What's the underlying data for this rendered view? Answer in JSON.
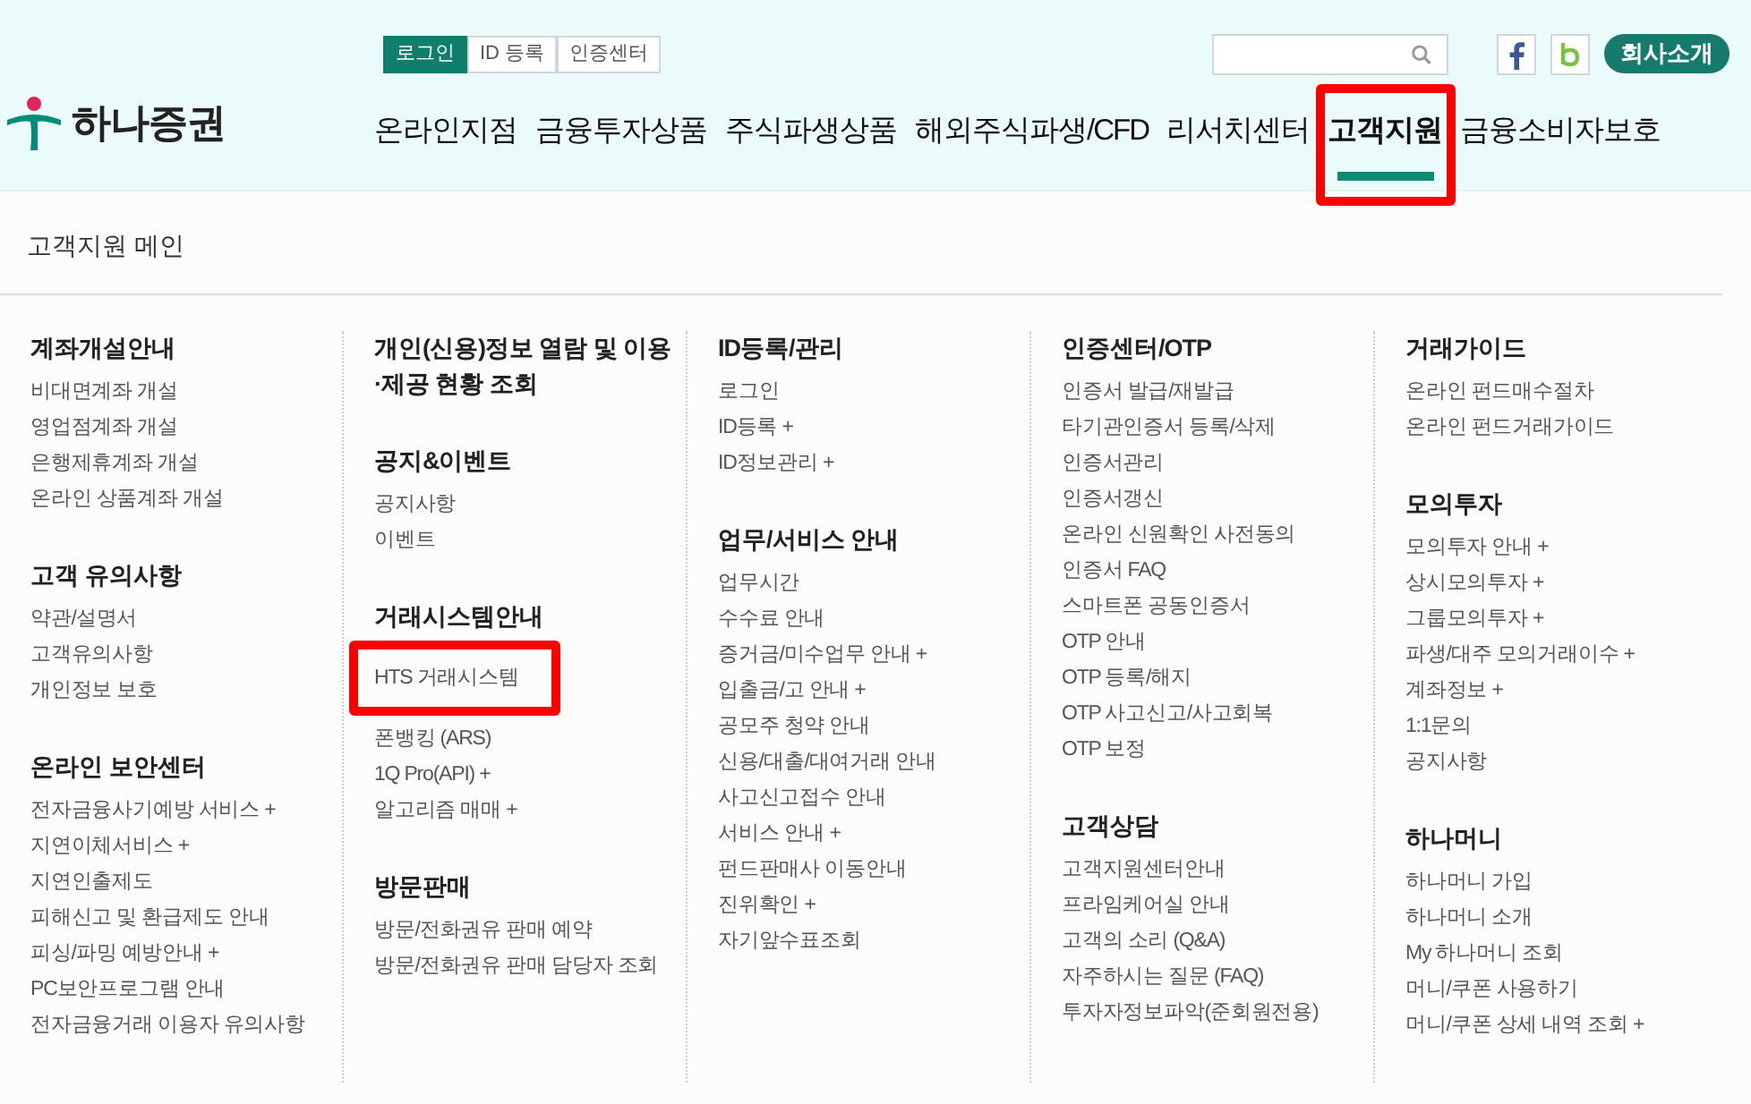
{
  "header": {
    "logo": "하나증권",
    "top_links": [
      {
        "label": "로그인",
        "selected": true
      },
      {
        "label": "ID 등록",
        "selected": false
      },
      {
        "label": "인증센터",
        "selected": false
      }
    ],
    "company_button": "회사소개",
    "nav": [
      {
        "label": "온라인지점",
        "selected": false,
        "highlighted": false
      },
      {
        "label": "금융투자상품",
        "selected": false,
        "highlighted": false
      },
      {
        "label": "주식파생상품",
        "selected": false,
        "highlighted": false
      },
      {
        "label": "해외주식파생/CFD",
        "selected": false,
        "highlighted": false
      },
      {
        "label": "리서치센터",
        "selected": false,
        "highlighted": false
      },
      {
        "label": "고객지원",
        "selected": true,
        "highlighted": true
      },
      {
        "label": "금융소비자보호",
        "selected": false,
        "highlighted": false
      }
    ]
  },
  "page_title": "고객지원 메인",
  "columns": [
    {
      "sections": [
        {
          "heading": "계좌개설안내",
          "links": [
            {
              "label": "비대면계좌 개설",
              "highlighted": false
            },
            {
              "label": "영업점계좌 개설",
              "highlighted": false
            },
            {
              "label": "은행제휴계좌 개설",
              "highlighted": false
            },
            {
              "label": "온라인 상품계좌 개설",
              "highlighted": false
            }
          ]
        },
        {
          "heading": "고객 유의사항",
          "links": [
            {
              "label": "약관/설명서",
              "highlighted": false
            },
            {
              "label": "고객유의사항",
              "highlighted": false
            },
            {
              "label": "개인정보 보호",
              "highlighted": false
            }
          ]
        },
        {
          "heading": "온라인 보안센터",
          "links": [
            {
              "label": "전자금융사기예방 서비스 +",
              "highlighted": false
            },
            {
              "label": "지연이체서비스 +",
              "highlighted": false
            },
            {
              "label": "지연인출제도",
              "highlighted": false
            },
            {
              "label": "피해신고 및 환급제도 안내",
              "highlighted": false
            },
            {
              "label": "피싱/파밍 예방안내 +",
              "highlighted": false
            },
            {
              "label": "PC보안프로그램 안내",
              "highlighted": false
            },
            {
              "label": "전자금융거래 이용자 유의사항",
              "highlighted": false
            }
          ]
        }
      ]
    },
    {
      "sections": [
        {
          "heading": "개인(신용)정보 열람 및 이용·제공 현황 조회"
        },
        {
          "heading": "공지&이벤트",
          "links": [
            {
              "label": "공지사항",
              "highlighted": false
            },
            {
              "label": "이벤트",
              "highlighted": false
            }
          ]
        },
        {
          "heading": "거래시스템안내",
          "links": [
            {
              "label": "HTS 거래시스템",
              "highlighted": true
            },
            {
              "label": "폰뱅킹 (ARS)",
              "highlighted": false
            },
            {
              "label": "1Q Pro(API) +",
              "highlighted": false
            },
            {
              "label": "알고리즘 매매 +",
              "highlighted": false
            }
          ]
        },
        {
          "heading": "방문판매",
          "links": [
            {
              "label": "방문/전화권유 판매 예약",
              "highlighted": false
            },
            {
              "label": "방문/전화권유 판매 담당자 조회",
              "highlighted": false
            }
          ]
        }
      ]
    },
    {
      "sections": [
        {
          "heading": "ID등록/관리",
          "links": [
            {
              "label": "로그인",
              "highlighted": false
            },
            {
              "label": "ID등록 +",
              "highlighted": false
            },
            {
              "label": "ID정보관리 +",
              "highlighted": false
            }
          ]
        },
        {
          "heading": "업무/서비스 안내",
          "links": [
            {
              "label": "업무시간",
              "highlighted": false
            },
            {
              "label": "수수료 안내",
              "highlighted": false
            },
            {
              "label": "증거금/미수업무 안내 +",
              "highlighted": false
            },
            {
              "label": "입출금/고 안내 +",
              "highlighted": false
            },
            {
              "label": "공모주 청약 안내",
              "highlighted": false
            },
            {
              "label": "신용/대출/대여거래 안내",
              "highlighted": false
            },
            {
              "label": "사고신고접수 안내",
              "highlighted": false
            },
            {
              "label": "서비스 안내 +",
              "highlighted": false
            },
            {
              "label": "펀드판매사 이동안내",
              "highlighted": false
            },
            {
              "label": "진위확인 +",
              "highlighted": false
            },
            {
              "label": "자기앞수표조회",
              "highlighted": false
            }
          ]
        }
      ]
    },
    {
      "sections": [
        {
          "heading": "인증센터/OTP",
          "links": [
            {
              "label": "인증서 발급/재발급",
              "highlighted": false
            },
            {
              "label": "타기관인증서 등록/삭제",
              "highlighted": false
            },
            {
              "label": "인증서관리",
              "highlighted": false
            },
            {
              "label": "인증서갱신",
              "highlighted": false
            },
            {
              "label": "온라인 신원확인 사전동의",
              "highlighted": false
            },
            {
              "label": "인증서 FAQ",
              "highlighted": false
            },
            {
              "label": "스마트폰 공동인증서",
              "highlighted": false
            },
            {
              "label": "OTP 안내",
              "highlighted": false
            },
            {
              "label": "OTP 등록/해지",
              "highlighted": false
            },
            {
              "label": "OTP 사고신고/사고회복",
              "highlighted": false
            },
            {
              "label": "OTP 보정",
              "highlighted": false
            }
          ]
        },
        {
          "heading": "고객상담",
          "links": [
            {
              "label": "고객지원센터안내",
              "highlighted": false
            },
            {
              "label": "프라임케어실 안내",
              "highlighted": false
            },
            {
              "label": "고객의 소리 (Q&A)",
              "highlighted": false
            },
            {
              "label": "자주하시는 질문 (FAQ)",
              "highlighted": false
            },
            {
              "label": "투자자정보파악(준회원전용)",
              "highlighted": false
            }
          ]
        }
      ]
    },
    {
      "sections": [
        {
          "heading": "거래가이드",
          "links": [
            {
              "label": "온라인 펀드매수절차",
              "highlighted": false
            },
            {
              "label": "온라인 펀드거래가이드",
              "highlighted": false
            }
          ]
        },
        {
          "heading": "모의투자",
          "links": [
            {
              "label": "모의투자 안내 +",
              "highlighted": false
            },
            {
              "label": "상시모의투자 +",
              "highlighted": false
            },
            {
              "label": "그룹모의투자 +",
              "highlighted": false
            },
            {
              "label": "파생/대주 모의거래이수 +",
              "highlighted": false
            },
            {
              "label": "계좌정보 +",
              "highlighted": false
            },
            {
              "label": "1:1문의",
              "highlighted": false
            },
            {
              "label": "공지사항",
              "highlighted": false
            }
          ]
        },
        {
          "heading": "하나머니",
          "links": [
            {
              "label": "하나머니 가입",
              "highlighted": false
            },
            {
              "label": "하나머니 소개",
              "highlighted": false
            },
            {
              "label": "My 하나머니 조회",
              "highlighted": false
            },
            {
              "label": "머니/쿠폰 사용하기",
              "highlighted": false
            },
            {
              "label": "머니/쿠폰 상세 내역 조회 +",
              "highlighted": false
            }
          ]
        }
      ]
    }
  ]
}
